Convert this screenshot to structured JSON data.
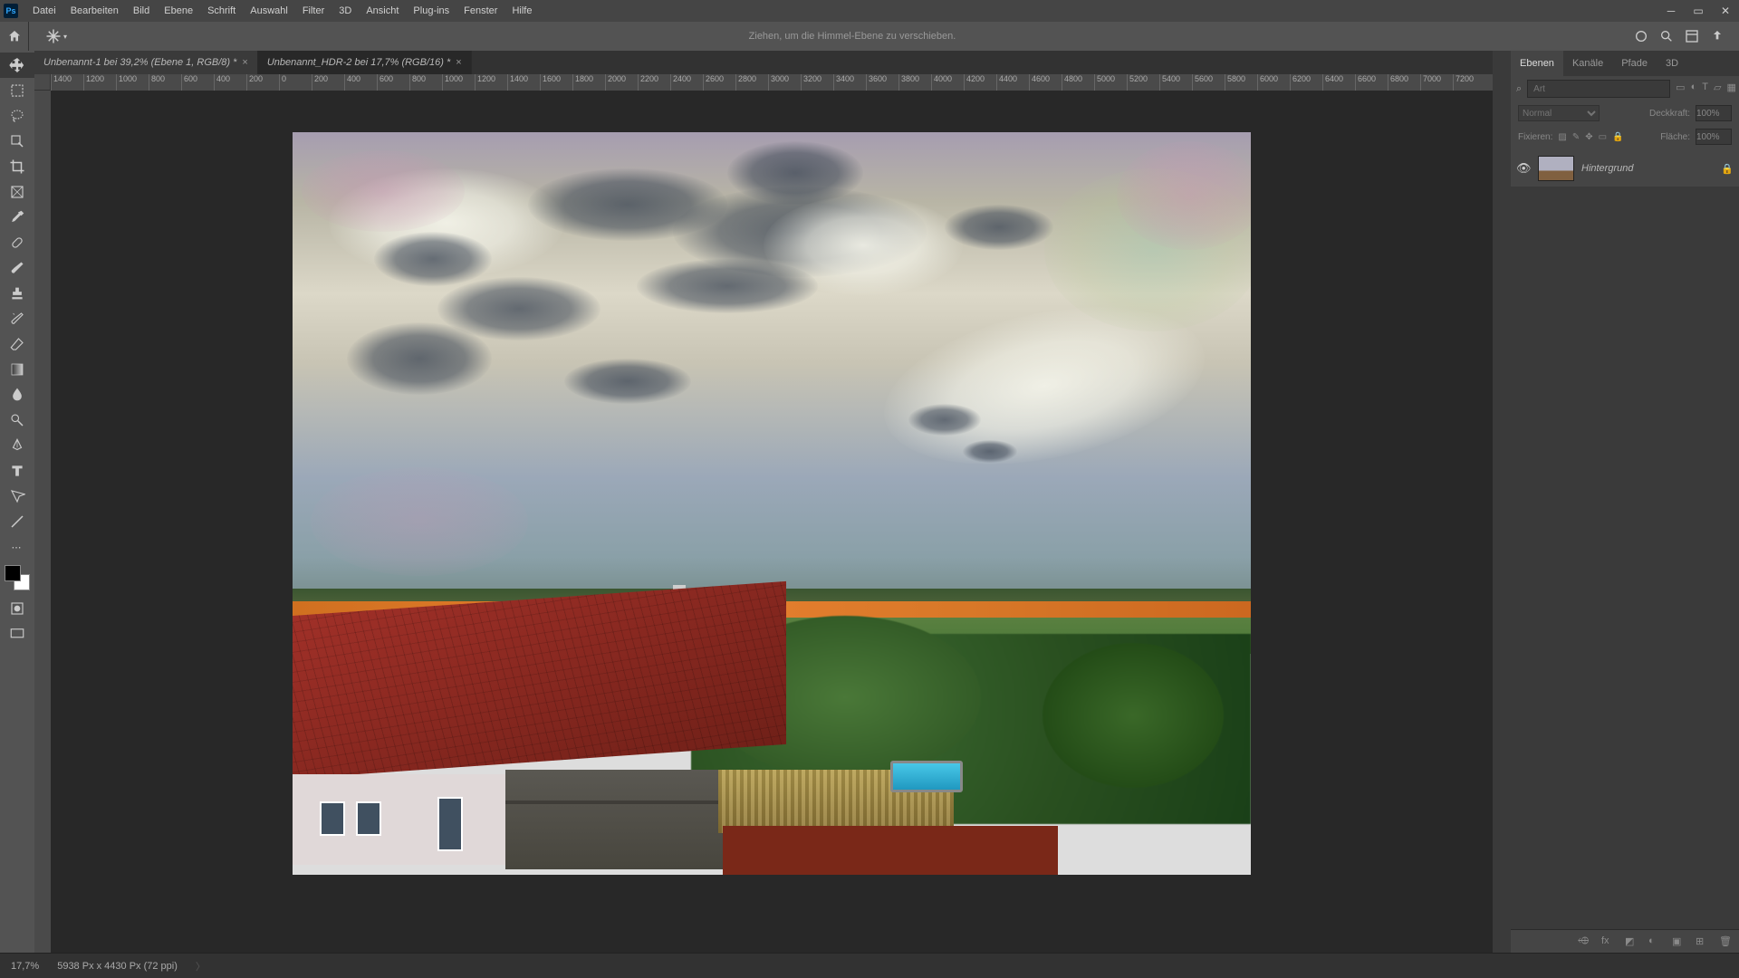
{
  "app": {
    "logo": "Ps"
  },
  "menu": [
    "Datei",
    "Bearbeiten",
    "Bild",
    "Ebene",
    "Schrift",
    "Auswahl",
    "Filter",
    "3D",
    "Ansicht",
    "Plug-ins",
    "Fenster",
    "Hilfe"
  ],
  "options": {
    "hint": "Ziehen, um die Himmel-Ebene zu verschieben."
  },
  "tabs": [
    {
      "label": "Unbenannt-1 bei 39,2% (Ebene 1, RGB/8) *",
      "active": false
    },
    {
      "label": "Unbenannt_HDR-2 bei 17,7% (RGB/16) *",
      "active": true
    }
  ],
  "ruler": {
    "ticks": [
      "1400",
      "1200",
      "1000",
      "800",
      "600",
      "400",
      "200",
      "0",
      "200",
      "400",
      "600",
      "800",
      "1000",
      "1200",
      "1400",
      "1600",
      "1800",
      "2000",
      "2200",
      "2400",
      "2600",
      "2800",
      "3000",
      "3200",
      "3400",
      "3600",
      "3800",
      "4000",
      "4200",
      "4400",
      "4600",
      "4800",
      "5000",
      "5200",
      "5400",
      "5600",
      "5800",
      "6000",
      "6200",
      "6400",
      "6600",
      "6800",
      "7000",
      "7200"
    ]
  },
  "panels": {
    "tabs": [
      "Ebenen",
      "Kanäle",
      "Pfade",
      "3D"
    ],
    "search_placeholder": "Art",
    "blend_label": "Normal",
    "opacity_label": "Deckkraft:",
    "opacity_value": "100%",
    "lock_label": "Fixieren:",
    "fill_label": "Fläche:",
    "fill_value": "100%",
    "layer": {
      "name": "Hintergrund"
    }
  },
  "status": {
    "zoom": "17,7%",
    "dims": "5938 Px x 4430 Px (72 ppi)"
  },
  "colors": {
    "panel": "#454545",
    "dark": "#323232",
    "accent": "#31a8ff"
  }
}
